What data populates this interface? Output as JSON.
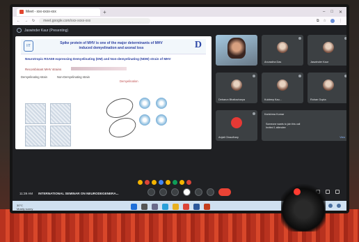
{
  "browser": {
    "tab_title": "Meet - xxx-xxxx-xxx",
    "url": "meet.google.com/xxx-xxxx-xxx"
  },
  "meeting": {
    "presenter_label": "Jaswinder Kaur (Presenting)",
    "time": "11:39 AM",
    "title": "INTERNATIONAL SEMINAR ON NEURODEGENERA..."
  },
  "slide": {
    "logo_text": "IIT",
    "title_line1": "Spike protein of MHV is one of the major determinants of MHV",
    "title_line2": "induced demyelination and axonal loss",
    "corner_letter": "D",
    "subtitle": "Neurotropic RSA59 expressing Demyelinating (DM) and Non-demyelinating (NDM) strain of MHV",
    "row1_label": "Recombinant MHV strains",
    "row2_label": "Demyelinating strain",
    "row2_label_b": "Non-Demyelinating strain",
    "mid_label": "Demyelination"
  },
  "participants": [
    {
      "name": "Jaswinder Kaur"
    },
    {
      "name": "Anuradha Das"
    },
    {
      "name": "Debarun Bhattacharya"
    },
    {
      "name": "Kuldeep Kau..."
    },
    {
      "name": "Rohan Gupta"
    },
    {
      "name": "Karishma Kumar"
    },
    {
      "name": "Anjali Chaudhary"
    }
  ],
  "chat": {
    "line1": "Someone wants to join this call",
    "line2": "Invited 1 attendee",
    "action": "View"
  },
  "taskbar": {
    "weather_line1": "30°C",
    "weather_line2": "Mostly sunny"
  }
}
